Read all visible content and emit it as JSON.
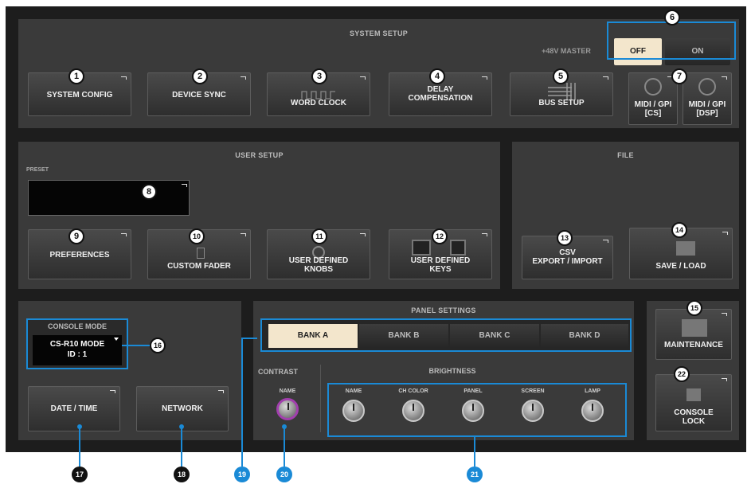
{
  "system_setup": {
    "title": "SYSTEM SETUP",
    "phantom_label": "+48V MASTER",
    "off_label": "OFF",
    "on_label": "ON",
    "buttons": {
      "system_config": "SYSTEM CONFIG",
      "device_sync": "DEVICE SYNC",
      "word_clock": "WORD CLOCK",
      "delay_comp": "DELAY\nCOMPENSATION",
      "bus_setup": "BUS SETUP",
      "midi_cs": "MIDI / GPI\n[CS]",
      "midi_dsp": "MIDI / GPI\n[DSP]"
    }
  },
  "user_setup": {
    "title": "USER SETUP",
    "preset_label": "PRESET",
    "preset_value": "",
    "buttons": {
      "preferences": "PREFERENCES",
      "custom_fader": "CUSTOM FADER",
      "user_knobs": "USER DEFINED\nKNOBS",
      "user_keys": "USER DEFINED\nKEYS"
    }
  },
  "file": {
    "title": "FILE",
    "csv": "CSV\nEXPORT / IMPORT",
    "save_load": "SAVE / LOAD"
  },
  "console": {
    "mode_label": "CONSOLE MODE",
    "mode_value": "CS-R10 MODE\nID : 1",
    "date_time": "DATE / TIME",
    "network": "NETWORK"
  },
  "panel_settings": {
    "title": "PANEL SETTINGS",
    "banks": [
      "BANK A",
      "BANK B",
      "BANK C",
      "BANK D"
    ],
    "selected_bank": "BANK A",
    "contrast_label": "CONTRAST",
    "contrast_knob": "NAME",
    "brightness_label": "BRIGHTNESS",
    "brightness_knobs": [
      "NAME",
      "CH COLOR",
      "PANEL",
      "SCREEN",
      "LAMP"
    ]
  },
  "maintenance": {
    "maintenance": "MAINTENANCE",
    "console_lock": "CONSOLE\nLOCK"
  },
  "callouts": [
    "1",
    "2",
    "3",
    "4",
    "5",
    "6",
    "7",
    "8",
    "9",
    "10",
    "11",
    "12",
    "13",
    "14",
    "15",
    "16",
    "17",
    "18",
    "19",
    "20",
    "21",
    "22"
  ],
  "colors": {
    "highlight": "#1a8ad6",
    "selected_bank": "#f3e6cc",
    "contrast_ring": "#a23fae"
  }
}
